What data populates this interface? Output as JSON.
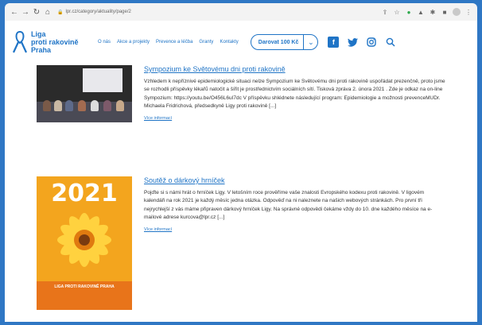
{
  "browser": {
    "url": "lpr.cz/category/aktuality/page/2"
  },
  "header": {
    "logo_lines": [
      "Liga",
      "proti rakovině",
      "Praha"
    ],
    "nav": [
      "O nás",
      "Akce a projekty",
      "Prevence a léčba",
      "Granty",
      "Kontakty"
    ],
    "donate_label": "Darovat 100 Kč"
  },
  "articles": [
    {
      "title": "Sympozium ke Světovému dni proti rakovině",
      "text": "Vzhledem k nepříznivé epidemiologické situaci nelze Sympozium ke Světovému dni proti rakovině uspořádat prezenčně, proto jsme se rozhodli příspěvky lékařů natočit a šířit je prostřednictvím sociálních sítí. Tisková zpráva 2. února 2021 . Zde je odkaz na on-line Sympozium: https://youtu.be/O456L6uI7dc V příspěvku shlédnete následující program: Epidemiologie a možnosti prevenceMUDr. Michaela Fridrichová, předsedkyně Ligy proti rakovině [...]",
      "more": "Více informací"
    },
    {
      "title": "Soutěž o dárkový hrníček",
      "text": "Pojďte si s námi hrát o hrníček Ligy. V letošním roce prověříme vaše znalosti Evropského kodexu proti rakovině. V ligovém kalendáři na rok 2021 je každý měsíc jedna otázka. Odpověď na ni naleznete na našich webových stránkách. Pro první tři nejrychlejší z vás máme připraven dárkový hrníček Ligy. Na správné odpovědi čekáme vždy do 10. dne každého měsíce na e-mailové adrese kurcova@lpr.cz [...]",
      "more": "Více informací",
      "image": {
        "year": "2021",
        "caption_title": "LIGA PROTI RAKOVINĚ PRAHA"
      }
    }
  ],
  "colors": {
    "brand": "#1f74c6",
    "frame": "#2f77c4",
    "calendar": "#f3a51e"
  },
  "icons": [
    "back-icon",
    "forward-icon",
    "reload-icon",
    "home-icon",
    "lock-icon",
    "share-icon",
    "star-icon",
    "facebook-icon",
    "twitter-icon",
    "instagram-icon",
    "search-icon",
    "chevron-down-icon"
  ]
}
